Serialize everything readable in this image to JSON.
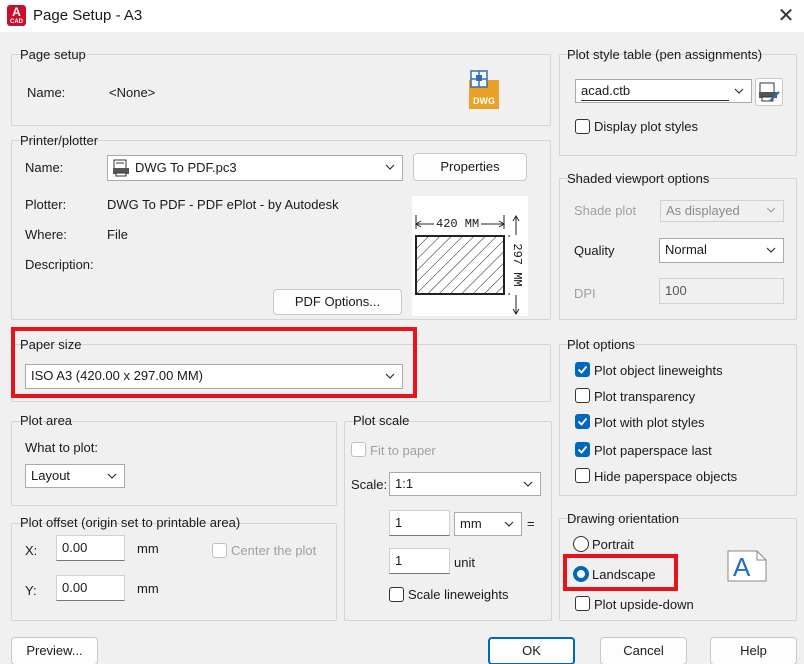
{
  "window": {
    "title": "Page Setup - A3",
    "close": "✕",
    "app_icon_letter": "A",
    "app_icon_sub": "CAD"
  },
  "page_setup": {
    "group": "Page setup",
    "name_label": "Name:",
    "name_value": "<None>",
    "dwg_icon_text": "DWG"
  },
  "printer": {
    "group": "Printer/plotter",
    "name_label": "Name:",
    "name_value": "DWG To PDF.pc3",
    "properties_button": "Properties",
    "plotter_label": "Plotter:",
    "plotter_value": "DWG To PDF - PDF ePlot - by Autodesk",
    "where_label": "Where:",
    "where_value": "File",
    "description_label": "Description:",
    "pdf_options_button": "PDF Options...",
    "preview_width": "420  MM",
    "preview_height": "297  MM"
  },
  "paper_size": {
    "group": "Paper size",
    "value": "ISO A3 (420.00 x 297.00 MM)"
  },
  "plot_area": {
    "group": "Plot area",
    "what_label": "What to plot:",
    "what_value": "Layout"
  },
  "plot_offset": {
    "group": "Plot offset (origin set to printable area)",
    "x_label": "X:",
    "x_value": "0.00",
    "x_unit": "mm",
    "y_label": "Y:",
    "y_value": "0.00",
    "y_unit": "mm",
    "center_label": "Center the plot"
  },
  "plot_scale": {
    "group": "Plot scale",
    "fit_label": "Fit to paper",
    "scale_label": "Scale:",
    "scale_value": "1:1",
    "num_value": "1",
    "num_unit": "mm",
    "equals": "=",
    "den_value": "1",
    "den_unit": "unit",
    "lineweights_label": "Scale lineweights"
  },
  "plot_style": {
    "group": "Plot style table (pen assignments)",
    "value": "acad.ctb",
    "display_label": "Display plot styles"
  },
  "shaded": {
    "group": "Shaded viewport options",
    "shade_label": "Shade plot",
    "shade_value": "As displayed",
    "quality_label": "Quality",
    "quality_value": "Normal",
    "dpi_label": "DPI",
    "dpi_value": "100"
  },
  "plot_options": {
    "group": "Plot options",
    "items": [
      {
        "label": "Plot object lineweights",
        "checked": true
      },
      {
        "label": "Plot transparency",
        "checked": false
      },
      {
        "label": "Plot with plot styles",
        "checked": true
      },
      {
        "label": "Plot paperspace last",
        "checked": true
      },
      {
        "label": "Hide paperspace objects",
        "checked": false
      }
    ]
  },
  "orientation": {
    "group": "Drawing orientation",
    "portrait": "Portrait",
    "landscape": "Landscape",
    "upside_down": "Plot upside-down",
    "icon_letter": "A"
  },
  "footer": {
    "preview": "Preview...",
    "ok": "OK",
    "cancel": "Cancel",
    "help": "Help"
  },
  "colors": {
    "accent": "#0067c0",
    "highlight": "#e8141a",
    "app_red": "#c8102e"
  }
}
